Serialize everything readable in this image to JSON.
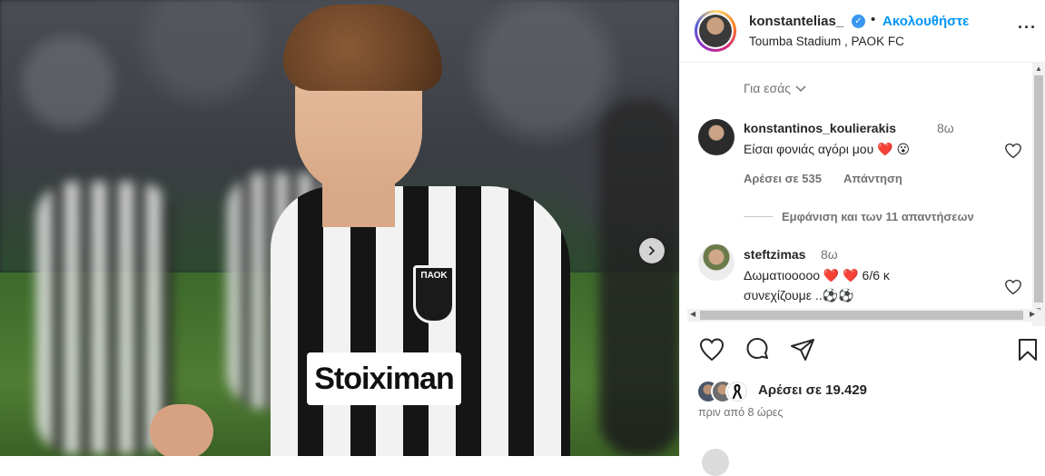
{
  "post": {
    "author": {
      "username": "konstantelias_",
      "verified": true,
      "separator": "•",
      "follow_label": "Ακολουθήστε",
      "location": "Toumba Stadium , PAOK FC"
    },
    "image": {
      "sponsor_text": "Stoiximan",
      "crest_text": "ΠΑΟΚ"
    }
  },
  "comments": {
    "sort_label": "Για εσάς",
    "items": [
      {
        "username": "konstantinos_koulierakis",
        "time": "8ω",
        "text": "Είσαι φονιάς αγόρι μου ❤️ 😮",
        "likes_label": "Αρέσει σε 535",
        "reply_label": "Απάντηση",
        "view_replies_label": "Εμφάνιση και των 11 απαντήσεων"
      },
      {
        "username": "steftzimas",
        "time": "8ω",
        "text_line1": "Δωματιοοοοο ❤️ ❤️  6/6 κ",
        "text_line2": "συνεχίζουμε ..⚽⚽"
      }
    ]
  },
  "footer": {
    "likes_label": "Αρέσει σε 19.429",
    "time_ago": "πριν από 8 ώρες"
  },
  "colors": {
    "accent": "#0095f6",
    "text": "#262626",
    "muted": "#737373"
  },
  "icons": [
    "more-icon",
    "heart-icon",
    "comment-icon",
    "share-icon",
    "bookmark-icon",
    "chevron-right-icon",
    "chevron-down-icon",
    "verified-icon"
  ]
}
